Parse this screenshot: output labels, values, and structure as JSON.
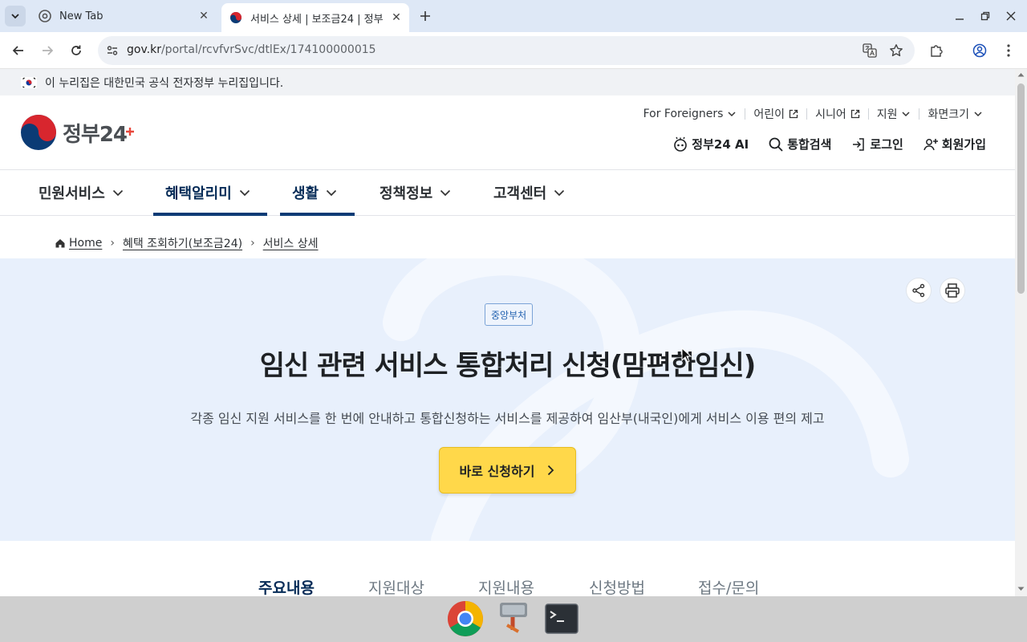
{
  "browser": {
    "tabs": [
      {
        "title": "New Tab",
        "active": false
      },
      {
        "title": "서비스 상세 | 보조금24 | 정부",
        "active": true
      }
    ],
    "url_host": "gov.kr",
    "url_path": "/portal/rcvfvrSvc/dtlEx/174100000015"
  },
  "gov_banner": "이 누리집은 대한민국 공식 전자정부 누리집입니다.",
  "header": {
    "logo_text": "정부24",
    "util": {
      "foreigners": "For Foreigners",
      "kids": "어린이",
      "senior": "시니어",
      "support": "지원",
      "screen_size": "화면크기"
    },
    "actions": {
      "ai": "정부24 AI",
      "search": "통합검색",
      "login": "로그인",
      "signup": "회원가입"
    }
  },
  "gnb": {
    "items": [
      {
        "label": "민원서비스"
      },
      {
        "label": "혜택알리미"
      },
      {
        "label": "생활"
      },
      {
        "label": "정책정보"
      },
      {
        "label": "고객센터"
      }
    ]
  },
  "breadcrumb": {
    "home": "Home",
    "level1": "혜택 조회하기(보조금24)",
    "level2": "서비스 상세"
  },
  "hero": {
    "badge": "중앙부처",
    "title": "임신 관련 서비스 통합처리 신청(맘편한임신)",
    "description": "각종 임신 지원 서비스를 한 번에 안내하고 통합신청하는 서비스를 제공하여 임산부(내국인)에게 서비스 이용 편의 제고",
    "apply_label": "바로 신청하기"
  },
  "content_tabs": {
    "items": [
      {
        "label": "주요내용"
      },
      {
        "label": "지원대상"
      },
      {
        "label": "지원내용"
      },
      {
        "label": "신청방법"
      },
      {
        "label": "접수/문의"
      }
    ]
  },
  "colors": {
    "primary": "#052b57",
    "hero_bg": "#e8f0fc",
    "apply_button": "#ffd84a"
  }
}
